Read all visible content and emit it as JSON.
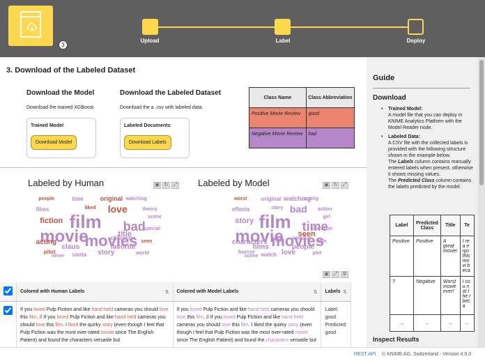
{
  "header": {
    "node_badge": "3",
    "steps": [
      {
        "label": "Upload",
        "state": "done"
      },
      {
        "label": "Label",
        "state": "done"
      },
      {
        "label": "Deploy",
        "state": "current"
      }
    ],
    "accent_color": "#fdd84e"
  },
  "main": {
    "title": "3. Download of the Labeled Dataset",
    "model": {
      "heading": "Download the Model",
      "desc": "Download the trained XGBoost.",
      "card_title": "Trained Model",
      "button": "Download Model"
    },
    "dataset": {
      "heading": "Download the Labeled Dataset",
      "desc": "Download the a .csv with labeled data.",
      "card_title": "Labeled Documents",
      "button": "Download Labels"
    },
    "legend": {
      "headers": [
        "Class Name",
        "Class Abbreviation"
      ],
      "rows": [
        {
          "name": "Positive Movie Review",
          "abbr": "good",
          "color": "#ec8570"
        },
        {
          "name": "Negative Movie Review",
          "abbr": "bad",
          "color": "#b586c8"
        }
      ]
    },
    "cloud_human": {
      "title": "Labeled by Human",
      "words": [
        "film",
        "movie",
        "movies",
        "love",
        "bad",
        "fiction",
        "story",
        "acting",
        "original",
        "title",
        "favorite",
        "claus",
        "santa",
        "films",
        "time",
        "character",
        "pilot",
        "watching",
        "seen",
        "special",
        "people",
        "liked",
        "theory",
        "never",
        "world",
        "scene"
      ]
    },
    "cloud_model": {
      "title": "Labeled by Model",
      "words": [
        "film",
        "movie",
        "movies",
        "bad",
        "time",
        "story",
        "love",
        "characters",
        "watching",
        "seen",
        "people",
        "films",
        "watch",
        "effects",
        "original",
        "special",
        "horror",
        "acting",
        "little",
        "character",
        "worst",
        "story",
        "action",
        "scene",
        "plot",
        "girl"
      ]
    },
    "table": {
      "headers": [
        "Colored with Human Labels",
        "Colored with Model Labels",
        "Labels"
      ],
      "row": {
        "human_text": "If you loved Pulp Fiction and like hand held cameras you should love this film. // If you loved Pulp Fiction and like hand held cameras you should love this film. I liked the quirky story (even though I feel that Pulp Fiction was the most over-rated movie since The English Patient) and found the characters versatile but",
        "model_text": "If you loved Pulp Fiction and like hand held cameras you should love this film. // If you loved Pulp Fiction and like hand held cameras you should love this film. I liked the quirky story (even though I feel that Pulp Fiction was the most over-rated movie since The English Patient) and found the characters versatile but",
        "label_line1": "Label:",
        "label_line2": "good",
        "label_line3": "Predicted:",
        "label_line4": "good"
      }
    }
  },
  "guide": {
    "title": "Guide",
    "section": "Download",
    "items": [
      {
        "bold": "Trained Model:",
        "text": "A model file that you can deploy in KNIME Analytics Platform with the Model Reader node."
      },
      {
        "bold": "Labeled Data:",
        "text": "A CSV file with the collected labels is provided with the following structure shown in the example below."
      }
    ],
    "labels_note_bold": "Labels",
    "labels_note": "column contains manually entered labels when present, otherwise it shows missing values.",
    "pred_note_bold": "Predicted Class",
    "pred_note": "column contains the labels predicted by the model.",
    "the": "The",
    "example": {
      "headers": [
        "Label",
        "Predicted Class",
        "Title",
        "Te"
      ],
      "rows": [
        [
          "Positive",
          "Positive",
          "A great movie!",
          "I rea enjo this movi beca"
        ],
        [
          "?",
          "Negative",
          "Worst movie ever!",
          "I cou not the r beca"
        ],
        [
          "...",
          "...",
          "...",
          "..."
        ]
      ]
    },
    "next_section": "Inspect Results"
  },
  "footer": {
    "rest_api": "REST API",
    "copyright": "© KNIME AG, Switzerland - Version 4.9.0"
  }
}
